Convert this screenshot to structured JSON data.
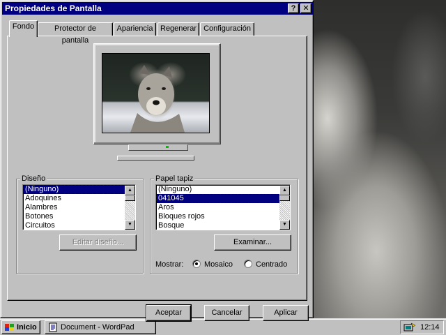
{
  "window": {
    "title": "Propiedades de Pantalla",
    "help_label": "?",
    "close_label": "✕"
  },
  "tabs": [
    {
      "label": "Fondo",
      "active": true
    },
    {
      "label": "Protector de pantalla",
      "active": false
    },
    {
      "label": "Apariencia",
      "active": false
    },
    {
      "label": "Regenerar",
      "active": false
    },
    {
      "label": "Configuración",
      "active": false
    }
  ],
  "design": {
    "legend": "Diseño",
    "items": [
      "(Ninguno)",
      "Adoquines",
      "Alambres",
      "Botones",
      "Circuitos"
    ],
    "selected": "(Ninguno)",
    "edit_button": "Editar diseño..."
  },
  "wallpaper": {
    "legend": "Papel tapiz",
    "items": [
      "(Ninguno)",
      "041045",
      "Aros",
      "Bloques rojos",
      "Bosque"
    ],
    "selected": "041045",
    "browse_button": "Examinar...",
    "show_label": "Mostrar:",
    "tile_label": "Mosaico",
    "center_label": "Centrado",
    "display_mode": "Mosaico"
  },
  "buttons": {
    "accept": "Aceptar",
    "cancel": "Cancelar",
    "apply": "Aplicar"
  },
  "taskbar": {
    "start_label": "Inicio",
    "task_label": "Document - WordPad",
    "clock": "12:14"
  },
  "icons": [
    "help-icon",
    "close-icon",
    "scroll-up-icon",
    "scroll-down-icon",
    "windows-logo-icon",
    "wordpad-icon",
    "tray-icon"
  ]
}
